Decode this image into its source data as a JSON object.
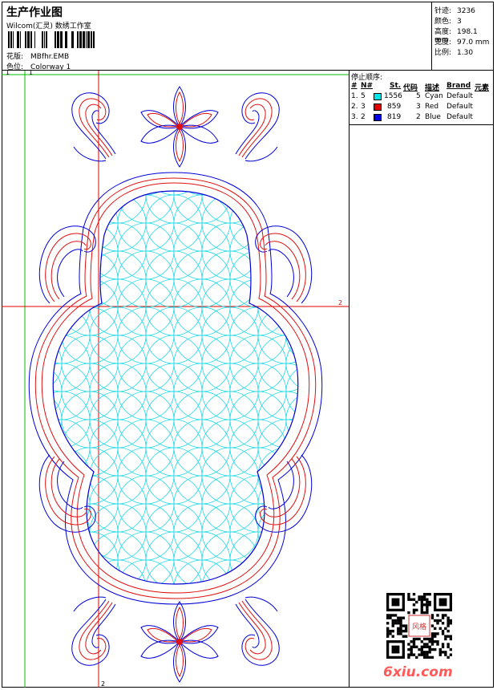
{
  "header": {
    "title": "生产作业图",
    "subtitle": "Wilcom(汇灵) 数绣工作室",
    "design_label": "花版:",
    "design_value": "MBfhr.EMB",
    "colorway_label": "色位:",
    "colorway_value": "Colorway 1"
  },
  "stats": [
    {
      "label": "针迹:",
      "value": "3236"
    },
    {
      "label": "颜色:",
      "value": "3"
    },
    {
      "label": "高度:",
      "value": "198.1 mm"
    },
    {
      "label": "宽度:",
      "value": "97.0 mm"
    },
    {
      "label": "比例:",
      "value": "1.30"
    }
  ],
  "guides": {
    "top_left": "1",
    "top_mark": "1",
    "right_mark": "2",
    "bottom_mark": "2"
  },
  "stop_sequence": {
    "title": "停止顺序:",
    "columns": [
      "#",
      "N#",
      "St.",
      "代码",
      "描述",
      "Brand",
      "元素"
    ],
    "rows": [
      {
        "idx": "1.",
        "n": "5",
        "color": "#00e5e5",
        "stitches": "1556",
        "code": "5",
        "desc": "Cyan",
        "brand": "Default"
      },
      {
        "idx": "2.",
        "n": "3",
        "color": "#e00000",
        "stitches": "859",
        "code": "3",
        "desc": "Red",
        "brand": "Default"
      },
      {
        "idx": "3.",
        "n": "2",
        "color": "#0000e0",
        "stitches": "819",
        "code": "2",
        "desc": "Blue",
        "brand": "Default"
      }
    ]
  },
  "watermark": {
    "stamp": "风格",
    "site": "6xiu.com"
  },
  "colors": {
    "cyan": "#19d9e6",
    "red": "#e01010",
    "blue": "#0000d8",
    "guide_red": "#e00000",
    "guide_green": "#00c000"
  }
}
